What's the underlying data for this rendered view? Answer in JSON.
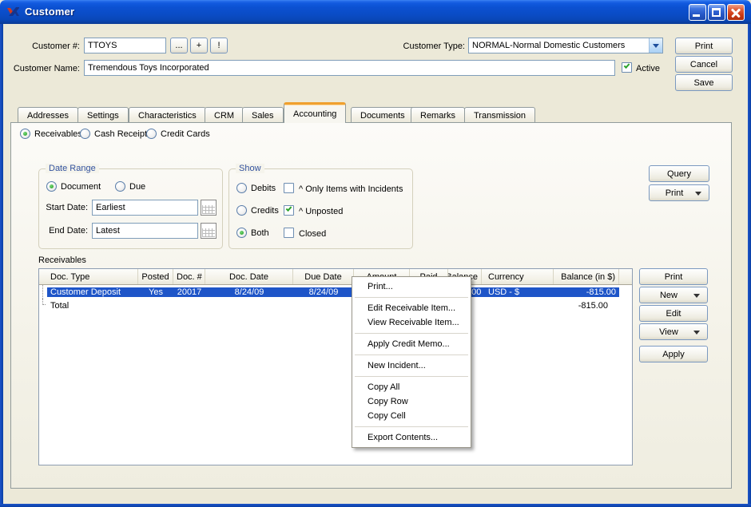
{
  "window": {
    "title": "Customer"
  },
  "colors": {
    "desktop_bg": "#ECE9D8",
    "titlebar_blue": "#0C51D2",
    "selection_blue": "#1E55C8",
    "tab_accent_orange": "#F0A02E",
    "check_green": "#2DA42D",
    "groupbox_label_blue": "#33529E"
  },
  "form": {
    "customer_no_label": "Customer #:",
    "customer_no_value": "TTOYS",
    "lookup_button": "...",
    "add_button": "+",
    "alert_button": "!",
    "customer_type_label": "Customer Type:",
    "customer_type_value": "NORMAL-Normal Domestic Customers",
    "customer_name_label": "Customer Name:",
    "customer_name_value": "Tremendous Toys Incorporated",
    "active_label": "Active",
    "active_checked": true,
    "print_button": "Print",
    "cancel_button": "Cancel",
    "save_button": "Save"
  },
  "tabs": [
    {
      "label": "Addresses",
      "selected": false
    },
    {
      "label": "Settings",
      "selected": false
    },
    {
      "label": "Characteristics",
      "selected": false
    },
    {
      "label": "CRM",
      "selected": false
    },
    {
      "label": "Sales",
      "selected": false
    },
    {
      "label": "Accounting",
      "selected": true
    },
    {
      "label": "Documents",
      "selected": false
    },
    {
      "label": "Remarks",
      "selected": false
    },
    {
      "label": "Transmission",
      "selected": false
    }
  ],
  "view_radios": [
    {
      "label": "Receivables",
      "selected": true
    },
    {
      "label": "Cash Receipts",
      "selected": false
    },
    {
      "label": "Credit Cards",
      "selected": false
    }
  ],
  "date_range": {
    "title": "Date Range",
    "document_radio": "Document",
    "document_selected": true,
    "due_radio": "Due",
    "due_selected": false,
    "start_label": "Start Date:",
    "start_value": "Earliest",
    "end_label": "End Date:",
    "end_value": "Latest"
  },
  "show": {
    "title": "Show",
    "radios": [
      {
        "label": "Debits",
        "selected": false
      },
      {
        "label": "Credits",
        "selected": false
      },
      {
        "label": "Both",
        "selected": true
      }
    ],
    "checkboxes": [
      {
        "label": "^ Only Items with Incidents",
        "checked": false
      },
      {
        "label": "^ Unposted",
        "checked": true
      },
      {
        "label": "Closed",
        "checked": false
      }
    ]
  },
  "query_button": "Query",
  "print_dropdown_button": "Print",
  "receivables": {
    "section_label": "Receivables",
    "columns": [
      "Doc. Type",
      "Posted",
      "Doc. #",
      "Doc. Date",
      "Due Date",
      "Amount",
      "Paid",
      "Balance",
      "Currency",
      "Balance (in $)"
    ],
    "row": {
      "doc_type": "Customer Deposit",
      "posted": "Yes",
      "doc_no": "20017",
      "doc_date": "8/24/09",
      "due_date": "8/24/09",
      "amount": "",
      "paid": "",
      "balance": "-815.00",
      "currency": "USD - $",
      "balance_usd": "-815.00"
    },
    "total_label": "Total",
    "total_balance_usd": "-815.00"
  },
  "side_buttons": {
    "print": "Print",
    "new": "New",
    "edit": "Edit",
    "view": "View",
    "apply": "Apply"
  },
  "context_menu": {
    "items": [
      "Print...",
      "Edit Receivable Item...",
      "View Receivable Item...",
      "Apply Credit Memo...",
      "New Incident...",
      "Copy All",
      "Copy Row",
      "Copy Cell",
      "Export Contents..."
    ]
  }
}
